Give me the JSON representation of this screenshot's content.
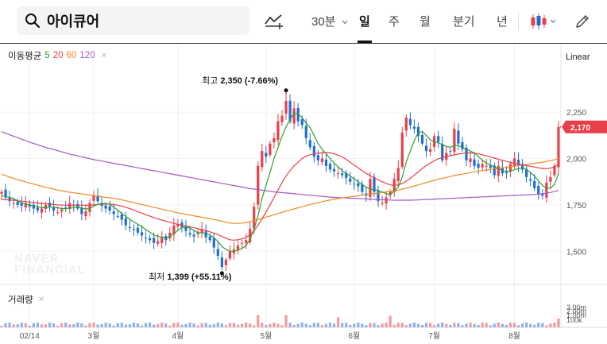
{
  "search": {
    "query": "아이큐어"
  },
  "toolbar": {
    "interval_label": "30분",
    "tabs": [
      {
        "label": "일",
        "active": true
      },
      {
        "label": "주",
        "active": false
      },
      {
        "label": "월",
        "active": false
      },
      {
        "label": "분기",
        "active": false
      },
      {
        "label": "년",
        "active": false
      }
    ],
    "icons": [
      "search-icon",
      "draw-indicator-icon",
      "chevron-down-icon",
      "candlestick-type-icon",
      "pencil-icon"
    ]
  },
  "legend": {
    "prefix": "이동평균",
    "ma": [
      {
        "label": "5",
        "color": "#2ca02c"
      },
      {
        "label": "20",
        "color": "#e8404a"
      },
      {
        "label": "60",
        "color": "#f08a24"
      },
      {
        "label": "120",
        "color": "#a259c4"
      }
    ]
  },
  "scale": "Linear",
  "volume_label": "거래량",
  "watermark": [
    "NAVER",
    "FINANCIAL"
  ],
  "annotations": {
    "high_prefix": "최고",
    "high_value": "2,350",
    "high_change": "(-7.66%)",
    "low_prefix": "최저",
    "low_value": "1,399",
    "low_change": "(+55.11%)"
  },
  "current_price": "2,170",
  "colors": {
    "up": "#e8404a",
    "down": "#1f6ed4",
    "current": "#e8404a"
  },
  "chart_data": {
    "type": "candlestick",
    "y_ticks": [
      "2,250",
      "2,000",
      "1,750",
      "1,500"
    ],
    "y_tick_values": [
      2250,
      2000,
      1750,
      1500
    ],
    "ylim": [
      1330,
      2520
    ],
    "x_labels": [
      "02/14",
      "3월",
      "4월",
      "5월",
      "6월",
      "7월",
      "8월"
    ],
    "volume_ticks": [
      "3.00m",
      "2.00m",
      "1.00m",
      "100k"
    ],
    "high": 2350,
    "low": 1399,
    "last": 2170,
    "closes": [
      1820,
      1790,
      1770,
      1760,
      1750,
      1745,
      1760,
      1740,
      1730,
      1720,
      1730,
      1750,
      1740,
      1720,
      1710,
      1725,
      1735,
      1760,
      1745,
      1730,
      1700,
      1715,
      1760,
      1800,
      1770,
      1745,
      1730,
      1720,
      1700,
      1690,
      1670,
      1640,
      1625,
      1615,
      1600,
      1585,
      1570,
      1560,
      1545,
      1555,
      1575,
      1560,
      1600,
      1640,
      1645,
      1630,
      1610,
      1590,
      1580,
      1600,
      1620,
      1575,
      1560,
      1520,
      1475,
      1415,
      1455,
      1500,
      1510,
      1530,
      1545,
      1560,
      1620,
      1740,
      1960,
      2040,
      2010,
      2080,
      2110,
      2200,
      2230,
      2310,
      2200,
      2270,
      2200,
      2180,
      2110,
      2060,
      2010,
      1990,
      2000,
      1960,
      1940,
      1930,
      1920,
      1910,
      1895,
      1875,
      1860,
      1850,
      1820,
      1800,
      1890,
      1820,
      1770,
      1760,
      1790,
      1820,
      1890,
      1950,
      2140,
      2220,
      2180,
      2160,
      2120,
      2080,
      2040,
      2050,
      2120,
      2090,
      1990,
      2030,
      2040,
      2160,
      2080,
      2050,
      1990,
      2000,
      1960,
      1950,
      1970,
      1960,
      1950,
      1910,
      1960,
      1920,
      1920,
      1970,
      2000,
      1960,
      1940,
      1900,
      1880,
      1840,
      1810,
      1800,
      1870,
      1900,
      1960,
      2170
    ],
    "ma5": [
      1800,
      1795,
      1790,
      1785,
      1770,
      1760,
      1755,
      1750,
      1745,
      1740,
      1735,
      1735,
      1738,
      1738,
      1735,
      1730,
      1730,
      1733,
      1735,
      1738,
      1733,
      1728,
      1730,
      1745,
      1752,
      1758,
      1758,
      1752,
      1738,
      1722,
      1703,
      1688,
      1673,
      1658,
      1645,
      1632,
      1617,
      1603,
      1588,
      1580,
      1577,
      1572,
      1580,
      1595,
      1612,
      1628,
      1630,
      1625,
      1612,
      1600,
      1600,
      1595,
      1587,
      1573,
      1553,
      1525,
      1510,
      1500,
      1500,
      1505,
      1515,
      1530,
      1565,
      1620,
      1690,
      1785,
      1855,
      1925,
      2000,
      2060,
      2120,
      2170,
      2210,
      2245,
      2240,
      2220,
      2190,
      2165,
      2125,
      2080,
      2050,
      2025,
      2000,
      1975,
      1955,
      1935,
      1920,
      1905,
      1890,
      1875,
      1860,
      1845,
      1835,
      1832,
      1828,
      1820,
      1810,
      1805,
      1825,
      1845,
      1900,
      1980,
      2040,
      2095,
      2140,
      2145,
      2125,
      2100,
      2090,
      2085,
      2075,
      2065,
      2060,
      2070,
      2070,
      2060,
      2050,
      2040,
      2030,
      2010,
      1990,
      1975,
      1965,
      1955,
      1945,
      1935,
      1930,
      1930,
      1940,
      1945,
      1950,
      1940,
      1925,
      1905,
      1880,
      1855,
      1840,
      1840,
      1860,
      1920
    ],
    "ma20": [
      1780,
      1779,
      1777,
      1775,
      1772,
      1770,
      1768,
      1765,
      1762,
      1760,
      1758,
      1756,
      1754,
      1752,
      1750,
      1749,
      1748,
      1748,
      1748,
      1748,
      1748,
      1748,
      1748,
      1750,
      1752,
      1754,
      1755,
      1754,
      1752,
      1748,
      1743,
      1737,
      1730,
      1722,
      1713,
      1705,
      1697,
      1690,
      1682,
      1675,
      1668,
      1662,
      1656,
      1650,
      1645,
      1641,
      1637,
      1632,
      1627,
      1622,
      1617,
      1612,
      1605,
      1598,
      1590,
      1580,
      1570,
      1562,
      1560,
      1562,
      1567,
      1575,
      1590,
      1610,
      1640,
      1675,
      1712,
      1750,
      1790,
      1830,
      1870,
      1905,
      1935,
      1960,
      1980,
      2000,
      2012,
      2020,
      2025,
      2028,
      2030,
      2032,
      2030,
      2025,
      2018,
      2008,
      1995,
      1980,
      1965,
      1950,
      1935,
      1920,
      1908,
      1895,
      1885,
      1875,
      1865,
      1858,
      1855,
      1858,
      1865,
      1878,
      1893,
      1910,
      1928,
      1946,
      1962,
      1976,
      1988,
      1998,
      2005,
      2010,
      2015,
      2020,
      2024,
      2027,
      2030,
      2030,
      2028,
      2025,
      2020,
      2014,
      2008,
      2002,
      1996,
      1990,
      1984,
      1979,
      1974,
      1970,
      1966,
      1962,
      1958,
      1954,
      1950,
      1946,
      1945,
      1948,
      1955,
      1970
    ],
    "ma60": [
      1915,
      1908,
      1900,
      1893,
      1886,
      1880,
      1874,
      1868,
      1862,
      1856,
      1850,
      1845,
      1840,
      1835,
      1830,
      1826,
      1822,
      1818,
      1815,
      1812,
      1809,
      1806,
      1803,
      1800,
      1797,
      1794,
      1791,
      1788,
      1785,
      1781,
      1777,
      1772,
      1767,
      1762,
      1757,
      1752,
      1747,
      1742,
      1737,
      1732,
      1727,
      1722,
      1717,
      1712,
      1707,
      1703,
      1699,
      1695,
      1691,
      1687,
      1683,
      1679,
      1675,
      1671,
      1667,
      1662,
      1657,
      1652,
      1650,
      1650,
      1652,
      1655,
      1660,
      1665,
      1671,
      1677,
      1684,
      1690,
      1697,
      1703,
      1710,
      1716,
      1722,
      1728,
      1734,
      1740,
      1746,
      1752,
      1757,
      1762,
      1767,
      1772,
      1776,
      1780,
      1784,
      1787,
      1790,
      1793,
      1796,
      1799,
      1802,
      1805,
      1808,
      1811,
      1814,
      1817,
      1820,
      1823,
      1826,
      1830,
      1835,
      1840,
      1846,
      1852,
      1858,
      1864,
      1870,
      1876,
      1882,
      1888,
      1893,
      1898,
      1903,
      1908,
      1912,
      1916,
      1920,
      1924,
      1928,
      1932,
      1935,
      1938,
      1941,
      1944,
      1947,
      1950,
      1953,
      1956,
      1959,
      1962,
      1965,
      1968,
      1971,
      1974,
      1977,
      1980,
      1984,
      1988,
      1993,
      1998
    ],
    "ma120": [
      2145,
      2136,
      2128,
      2120,
      2112,
      2104,
      2096,
      2088,
      2081,
      2074,
      2067,
      2060,
      2054,
      2048,
      2042,
      2036,
      2030,
      2024,
      2019,
      2014,
      2009,
      2004,
      1999,
      1994,
      1990,
      1986,
      1982,
      1978,
      1974,
      1970,
      1966,
      1962,
      1958,
      1954,
      1950,
      1946,
      1942,
      1938,
      1934,
      1930,
      1926,
      1922,
      1918,
      1914,
      1910,
      1906,
      1902,
      1898,
      1894,
      1890,
      1886,
      1882,
      1878,
      1874,
      1870,
      1866,
      1862,
      1858,
      1854,
      1850,
      1846,
      1842,
      1838,
      1835,
      1832,
      1829,
      1826,
      1823,
      1820,
      1818,
      1816,
      1814,
      1812,
      1810,
      1808,
      1806,
      1804,
      1802,
      1800,
      1798,
      1796,
      1794,
      1792,
      1790,
      1789,
      1788,
      1787,
      1786,
      1785,
      1784,
      1783,
      1782,
      1781,
      1780,
      1779,
      1778,
      1777,
      1776,
      1775,
      1775,
      1775,
      1775,
      1775,
      1776,
      1777,
      1778,
      1779,
      1780,
      1781,
      1782,
      1783,
      1784,
      1785,
      1786,
      1787,
      1788,
      1789,
      1790,
      1791,
      1792,
      1793,
      1794,
      1795,
      1796,
      1797,
      1798,
      1799,
      1800,
      1801,
      1802,
      1803,
      1804,
      1805,
      1806,
      1808,
      1810,
      1813,
      1817,
      1822,
      1828
    ]
  }
}
